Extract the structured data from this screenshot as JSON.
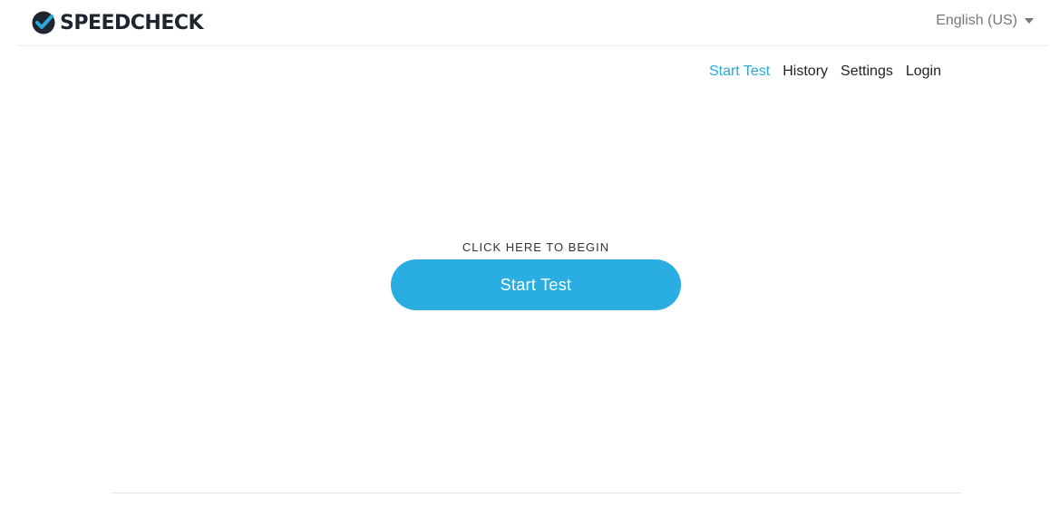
{
  "header": {
    "logo_text": "SPEEDCHECK",
    "language": "English (US)"
  },
  "nav": {
    "items": [
      {
        "label": "Start Test",
        "active": true
      },
      {
        "label": "History",
        "active": false
      },
      {
        "label": "Settings",
        "active": false
      },
      {
        "label": "Login",
        "active": false
      }
    ]
  },
  "main": {
    "begin_label": "CLICK HERE TO BEGIN",
    "start_button": "Start Test"
  },
  "colors": {
    "accent": "#2aaee2",
    "nav_active": "#2aa8dc",
    "logo_dark": "#1e2430"
  },
  "icons": {
    "logo": "speedcheck-gauge-check-icon",
    "language_toggle": "caret-down-icon"
  }
}
